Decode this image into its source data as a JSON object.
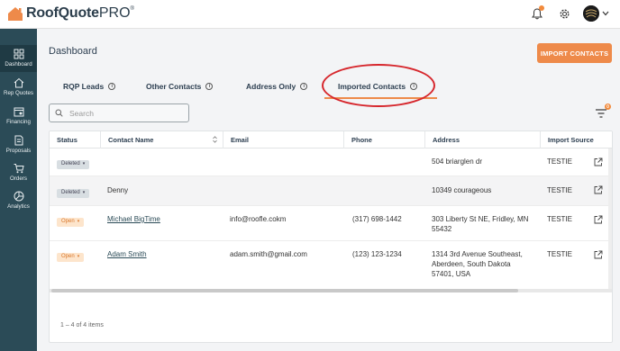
{
  "app": {
    "brand": "RoofQuote",
    "brand_suffix": "PRO",
    "registered": "®"
  },
  "sidebar": {
    "items": [
      {
        "label": "Dashboard",
        "icon": "dashboard-icon",
        "active": true
      },
      {
        "label": "Rep Quotes",
        "icon": "house-icon",
        "active": false
      },
      {
        "label": "Financing",
        "icon": "calendar-icon",
        "active": false
      },
      {
        "label": "Proposals",
        "icon": "document-icon",
        "active": false
      },
      {
        "label": "Orders",
        "icon": "cart-icon",
        "active": false
      },
      {
        "label": "Analytics",
        "icon": "pie-chart-icon",
        "active": false
      }
    ]
  },
  "header": {
    "title": "Dashboard",
    "import_button": "IMPORT CONTACTS"
  },
  "tabs": [
    {
      "label": "RQP Leads"
    },
    {
      "label": "Other Contacts"
    },
    {
      "label": "Address Only"
    },
    {
      "label": "Imported Contacts",
      "active": true
    }
  ],
  "search": {
    "placeholder": "Search"
  },
  "filter": {
    "badge": "0"
  },
  "table": {
    "columns": [
      "Status",
      "Contact Name",
      "Email",
      "Phone",
      "Address",
      "Import Source"
    ],
    "rows": [
      {
        "status": "Deleted",
        "name": "",
        "email": "",
        "phone": "",
        "address": "504 briarglen dr",
        "source": "TESTIE"
      },
      {
        "status": "Deleted",
        "name": "Denny",
        "email": "",
        "phone": "",
        "address": "10349 courageous",
        "source": "TESTIE"
      },
      {
        "status": "Open",
        "name": "Michael BigTime",
        "email": "info@roofle.cokm",
        "phone": "(317) 698-1442",
        "address": "303 Liberty St NE, Fridley, MN 55432",
        "source": "TESTIE"
      },
      {
        "status": "Open",
        "name": "Adam Smith",
        "email": "adam.smith@gmail.com",
        "phone": "(123) 123-1234",
        "address": "1314 3rd Avenue Southeast, Aberdeen, South Dakota 57401, USA",
        "source": "TESTIE"
      }
    ],
    "footer": "1 – 4 of 4 items"
  },
  "colors": {
    "accent": "#ee8a4a",
    "sidebar": "#2b4b57",
    "annotation_circle": "#d6262c"
  }
}
